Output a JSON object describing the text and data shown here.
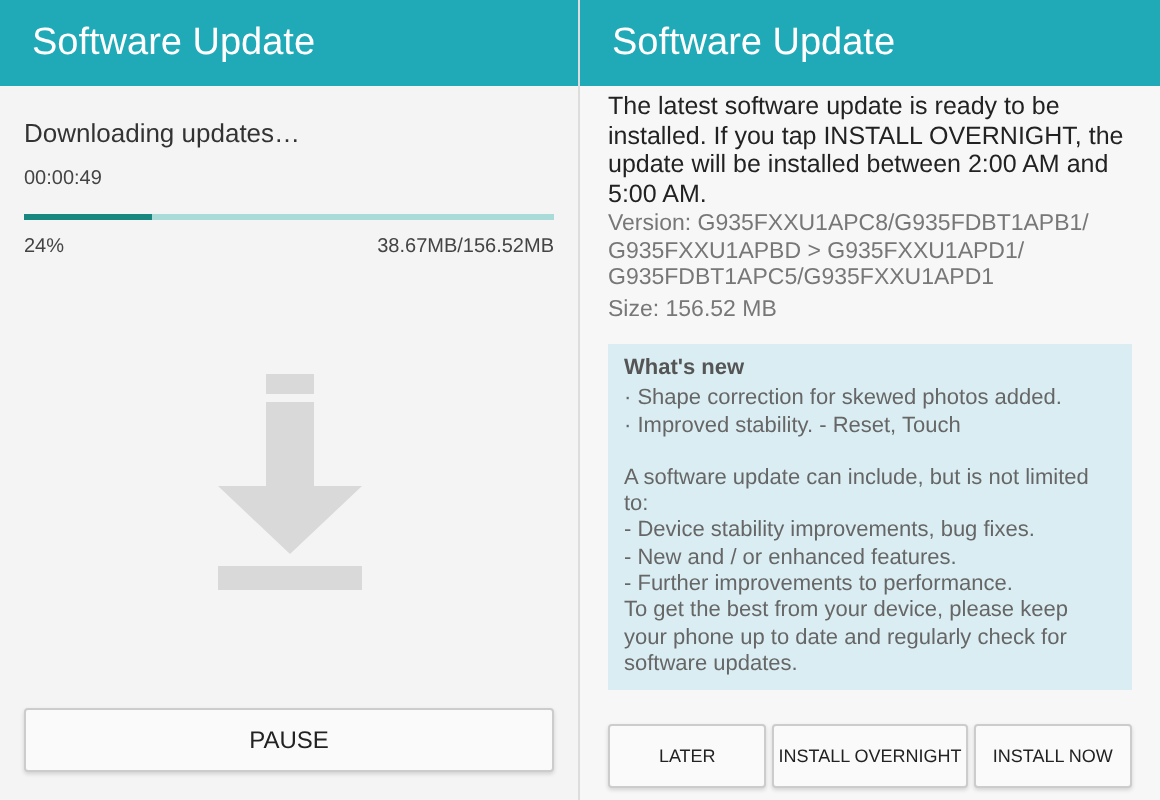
{
  "download_screen": {
    "title": "Software Update",
    "status": "Downloading updates…",
    "elapsed": "00:00:49",
    "progress": {
      "level": 0.24,
      "percent": "24%",
      "size": "38.67MB/156.52MB"
    },
    "button": "PAUSE"
  },
  "install_screen": {
    "title": "Software Update",
    "message": "The latest software update is ready to be installed. If you tap INSTALL OVERNIGHT, the update will be installed between 2:00 AM and 5:00 AM.",
    "version": "Version: G935FXXU1APC8/G935FDBT1APB1/ G935FXXU1APBD > G935FXXU1APD1/ G935FDBT1APC5/G935FXXU1APD1",
    "size": "Size: 156.52 MB",
    "whats_new": {
      "heading": "What's new",
      "items": [
        "· Shape correction for skewed photos added.",
        "· Improved stability. - Reset, Touch"
      ],
      "intro": "A software update can include, but is not limited to:",
      "bullets": [
        "- Device stability improvements, bug fixes.",
        "- New and / or enhanced features.",
        "- Further improvements to performance."
      ],
      "closing": "To get the best from your device, please keep your phone up to date and regularly check for software updates."
    },
    "buttons": [
      "LATER",
      "INSTALL OVERNIGHT",
      "INSTALL NOW"
    ]
  }
}
